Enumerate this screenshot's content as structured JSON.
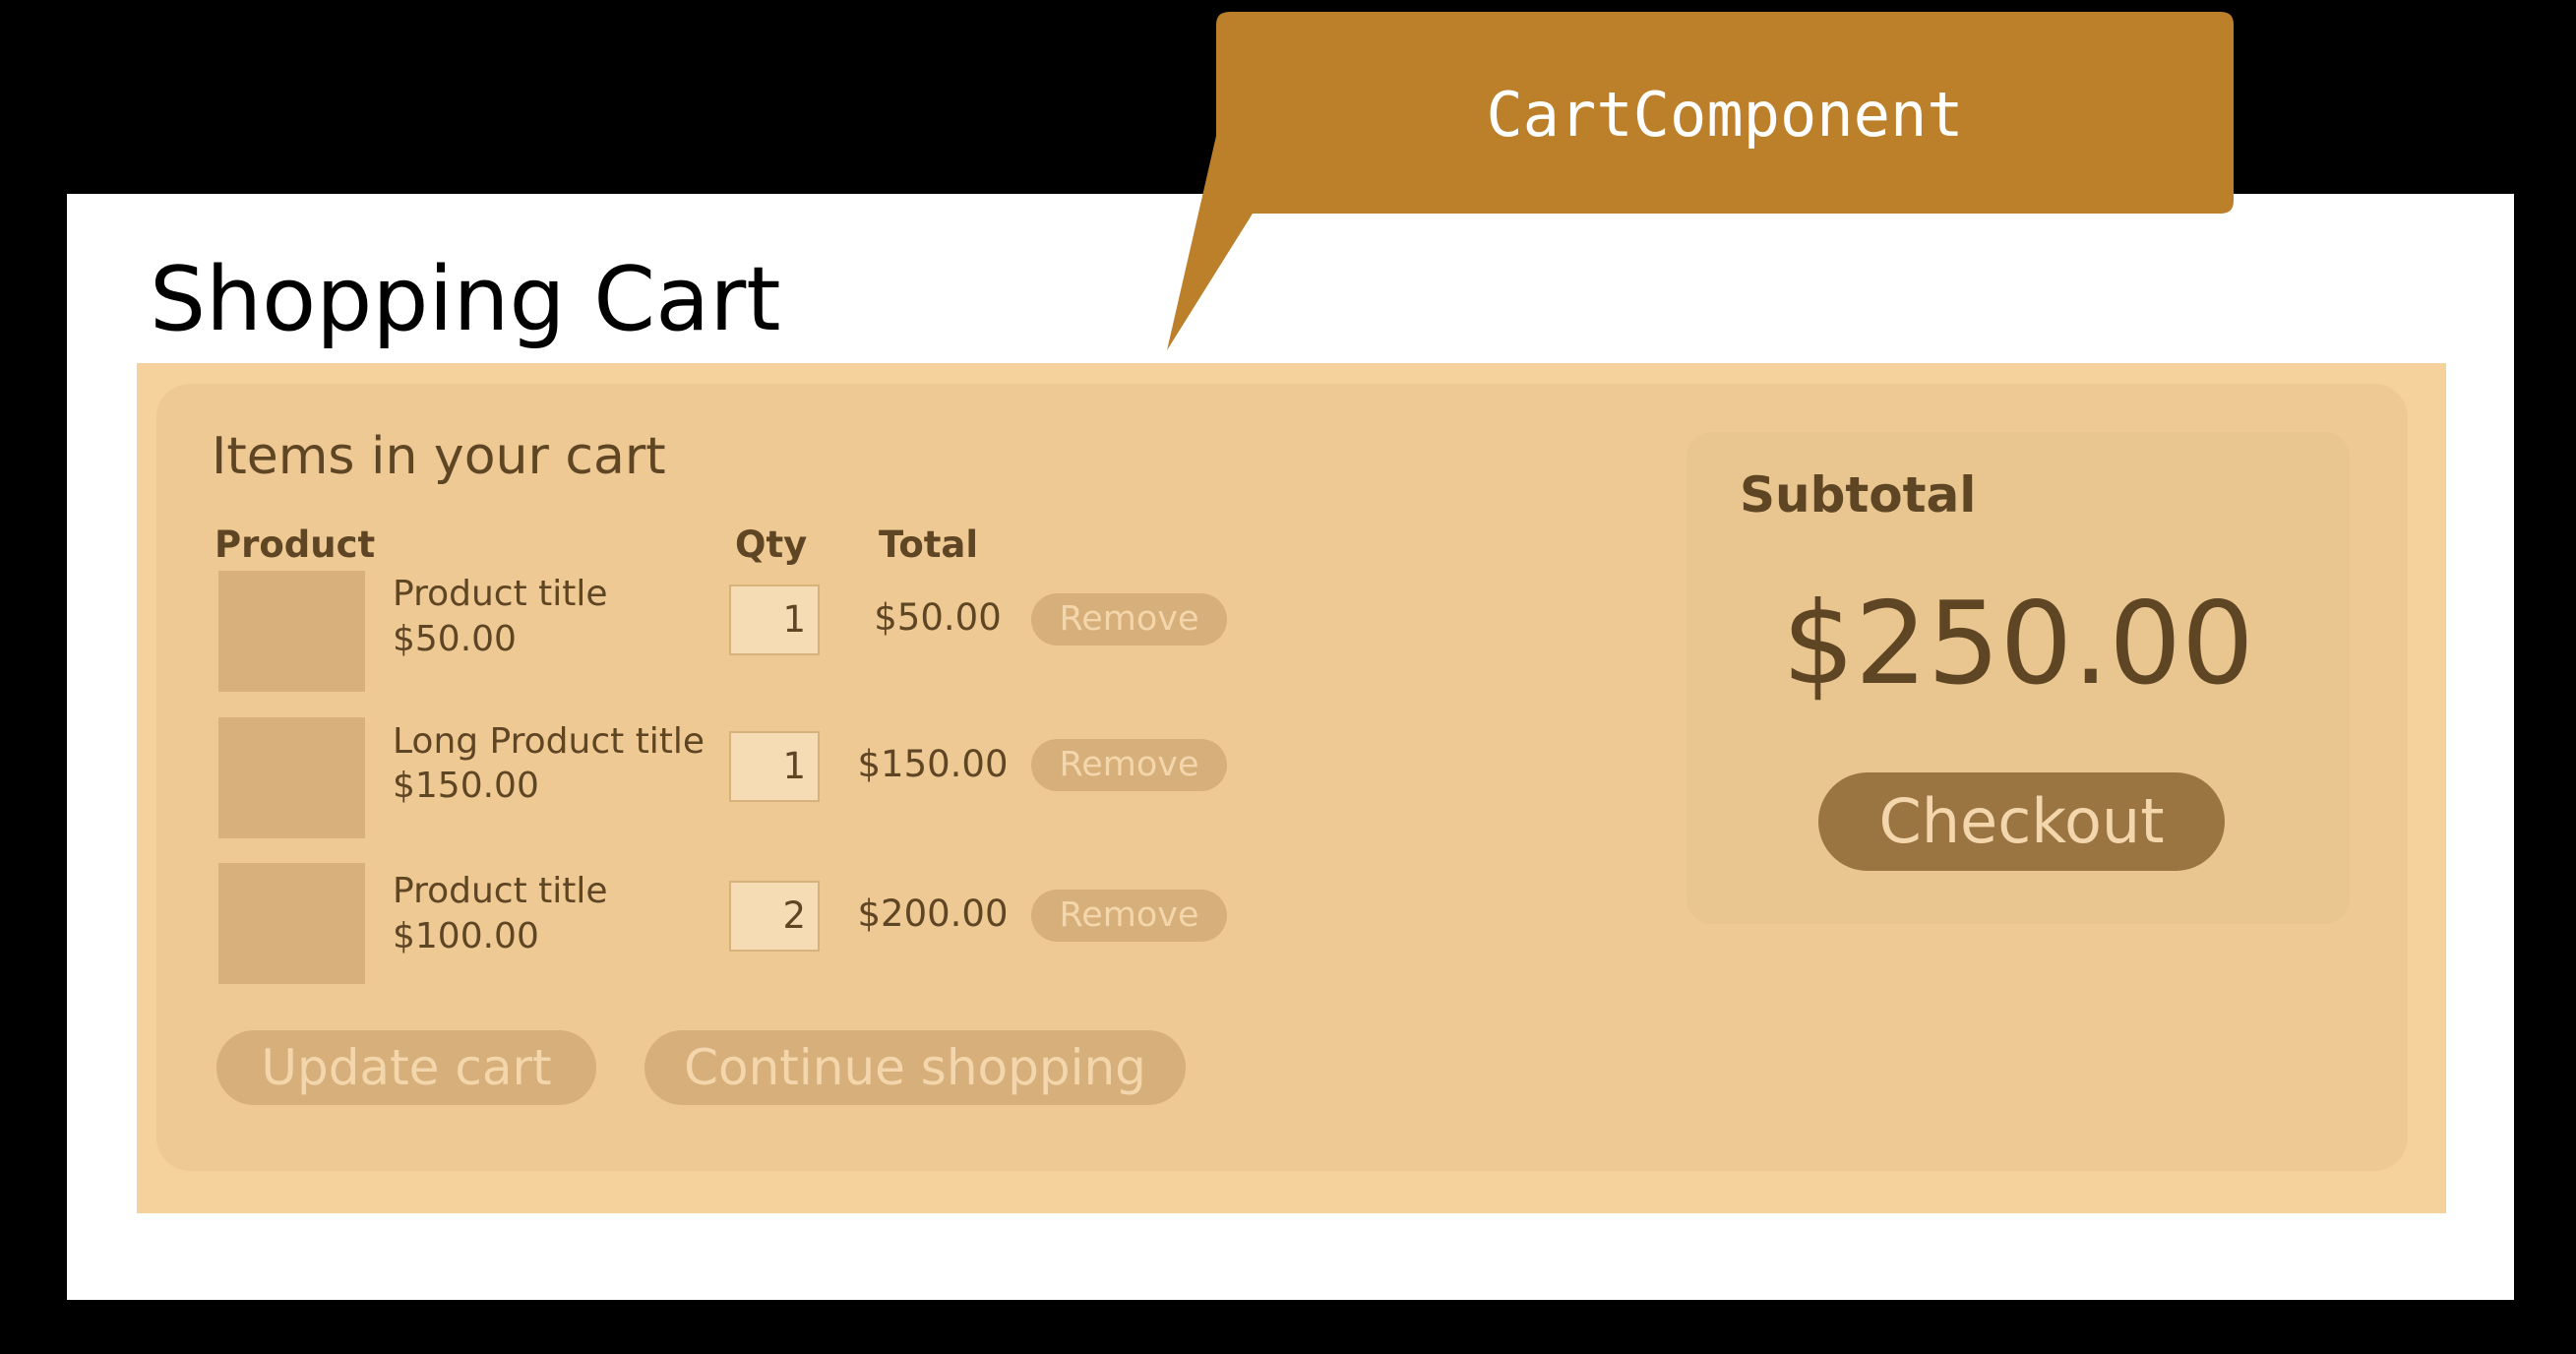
{
  "page": {
    "title": "Shopping Cart"
  },
  "callout": {
    "label": "CartComponent",
    "color": "#bc7f2a"
  },
  "cart": {
    "heading": "Items in your cart",
    "columns": {
      "product": "Product",
      "qty": "Qty",
      "total": "Total"
    },
    "items": [
      {
        "title": "Product title",
        "price": "$50.00",
        "qty": "1",
        "total": "$50.00",
        "remove_label": "Remove"
      },
      {
        "title": "Long Product title",
        "price": "$150.00",
        "qty": "1",
        "total": "$150.00",
        "remove_label": "Remove"
      },
      {
        "title": "Product title",
        "price": "$100.00",
        "qty": "2",
        "total": "$200.00",
        "remove_label": "Remove"
      }
    ],
    "update_label": "Update cart",
    "continue_label": "Continue shopping"
  },
  "summary": {
    "label": "Subtotal",
    "value": "$250.00",
    "checkout_label": "Checkout"
  },
  "colors": {
    "background": "#000000",
    "page": "#ffffff",
    "cart_region": "#f5d19c",
    "panel": "#eec993",
    "summary_box": "#e9c58f",
    "muted_button": "#d7af7a",
    "checkout_button": "#9a7441",
    "text": "#5e4524"
  }
}
